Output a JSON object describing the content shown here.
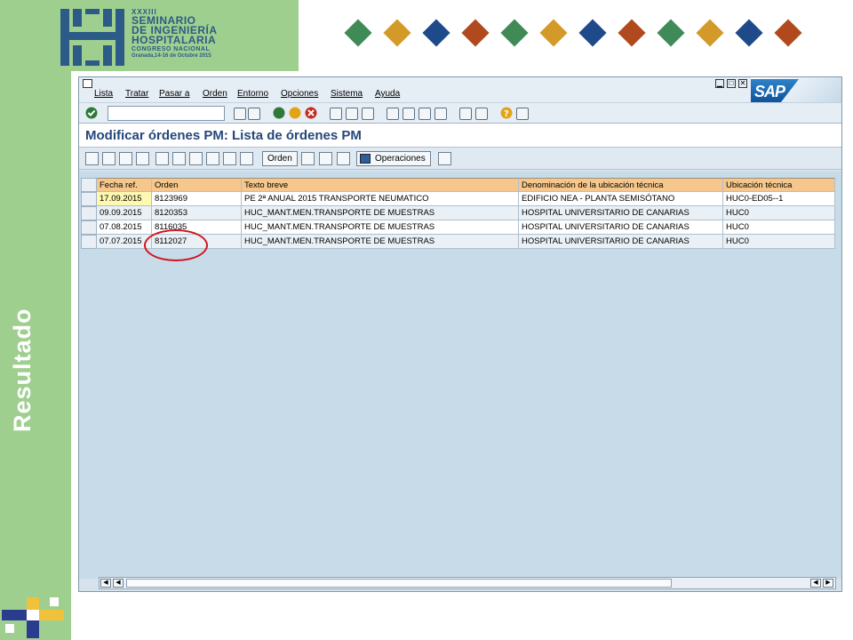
{
  "slide": {
    "side_label": "Resultado",
    "logo": {
      "line0": "XXXIII",
      "line1": "SEMINARIO",
      "line2": "DE INGENIERÍA",
      "line3": "HOSPITALARIA",
      "line4": "CONGRESO NACIONAL",
      "line5": "Granada,14-16 de Octubre 2015"
    },
    "diamond_colors": [
      "#3f8a57",
      "#d39a2a",
      "#1f4a8a",
      "#b04a1e",
      "#3f8a57",
      "#d39a2a",
      "#1f4a8a",
      "#b04a1e",
      "#3f8a57",
      "#d39a2a",
      "#1f4a8a",
      "#b04a1e"
    ]
  },
  "sap": {
    "menu": [
      "Lista",
      "Tratar",
      "Pasar a",
      "Orden",
      "Entorno",
      "Opciones",
      "Sistema",
      "Ayuda"
    ],
    "window_controls": [
      "▁",
      "□",
      "✕"
    ],
    "logo_text": "SAP",
    "title": "Modificar órdenes PM: Lista de órdenes PM",
    "app_buttons": {
      "orden": "Orden",
      "operaciones": "Operaciones"
    },
    "table": {
      "columns": [
        "Fecha ref.",
        "Orden",
        "Texto breve",
        "Denominación de la ubicación técnica",
        "Ubicación técnica"
      ],
      "rows": [
        [
          "17.09.2015",
          "8123969",
          "PE 2ª ANUAL 2015 TRANSPORTE NEUMATICO",
          "EDIFICIO NEA - PLANTA SEMISÓTANO",
          "HUC0-ED05--1"
        ],
        [
          "09.09.2015",
          "8120353",
          "HUC_MANT.MEN.TRANSPORTE DE MUESTRAS",
          "HOSPITAL UNIVERSITARIO DE CANARIAS",
          "HUC0"
        ],
        [
          "07.08.2015",
          "8116035",
          "HUC_MANT.MEN.TRANSPORTE DE MUESTRAS",
          "HOSPITAL UNIVERSITARIO DE CANARIAS",
          "HUC0"
        ],
        [
          "07.07.2015",
          "8112027",
          "HUC_MANT.MEN.TRANSPORTE DE MUESTRAS",
          "HOSPITAL UNIVERSITARIO DE CANARIAS",
          "HUC0"
        ]
      ]
    },
    "scroll_arrows": [
      "◀",
      "◀",
      "▶"
    ]
  }
}
